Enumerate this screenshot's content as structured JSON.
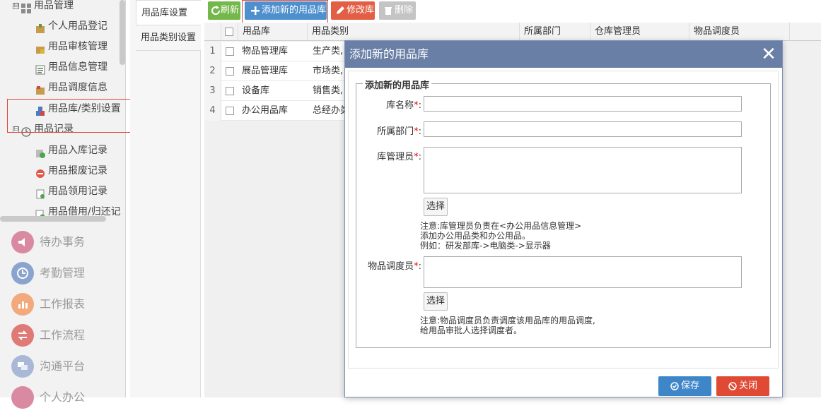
{
  "sidebar": {
    "tree": [
      {
        "label": "用品管理",
        "expander": "⊟",
        "icon": "grid-icon"
      },
      {
        "label": "个人用品登记",
        "icon": "package-icon"
      },
      {
        "label": "用品审核管理",
        "icon": "package-lock-icon"
      },
      {
        "label": "用品信息管理",
        "icon": "list-icon"
      },
      {
        "label": "用品调度信息",
        "icon": "package-icon"
      },
      {
        "label": "用品库/类别设置",
        "icon": "blocks-icon"
      },
      {
        "label": "用品记录",
        "expander": "⊟",
        "icon": "clock-icon"
      },
      {
        "label": "用品入库记录",
        "icon": "inbox-icon"
      },
      {
        "label": "用品报废记录",
        "icon": "minus-circle-icon"
      },
      {
        "label": "用品领用记录",
        "icon": "document-icon"
      },
      {
        "label": "用品借用/归还记",
        "icon": "exchange-icon"
      }
    ],
    "sections": [
      {
        "label": "待办事务",
        "icon": "speaker-icon",
        "color": "#d46a8a"
      },
      {
        "label": "考勤管理",
        "icon": "clock-icon",
        "color": "#6a8fc9"
      },
      {
        "label": "工作报表",
        "icon": "chart-icon",
        "color": "#f0965a"
      },
      {
        "label": "工作流程",
        "icon": "flow-icon",
        "color": "#d9534f"
      },
      {
        "label": "沟通平台",
        "icon": "chat-icon",
        "color": "#8aa0c8"
      },
      {
        "label": "个人办公",
        "icon": "person-icon",
        "color": "#d46a8a"
      }
    ]
  },
  "tabs": [
    "用品库设置",
    "用品类别设置"
  ],
  "toolbar": {
    "refresh": "刷新",
    "add": "添加新的用品库",
    "edit": "修改库",
    "delete": "删除"
  },
  "grid": {
    "columns": [
      "用品库",
      "用品类别",
      "所属部门",
      "仓库管理员",
      "物品调度员"
    ],
    "rows": [
      {
        "num": "1",
        "name": "物品管理库",
        "category": "生产类,"
      },
      {
        "num": "2",
        "name": "展品管理库",
        "category": "市场类,"
      },
      {
        "num": "3",
        "name": "设备库",
        "category": "销售类,"
      },
      {
        "num": "4",
        "name": "办公用品库",
        "category": "总经办类"
      }
    ]
  },
  "dialog": {
    "title": "添加新的用品库",
    "legend": "添加新的用品库",
    "fields": {
      "name": "库名称",
      "dept": "所属部门",
      "manager": "库管理员",
      "dispatcher": "物品调度员"
    },
    "required_mark": "*",
    "colon": ":",
    "select_label": "选择",
    "note1": [
      "注意:库管理员负责在<办公用品信息管理>",
      "添加办公用品类和办公用品。",
      "例如：研发部库->电脑类->显示器"
    ],
    "note2": [
      "注意:物品调度员负责调度该用品库的用品调度,",
      "给用品审批人选择调度者。"
    ],
    "save": "保存",
    "close": "关闭"
  }
}
